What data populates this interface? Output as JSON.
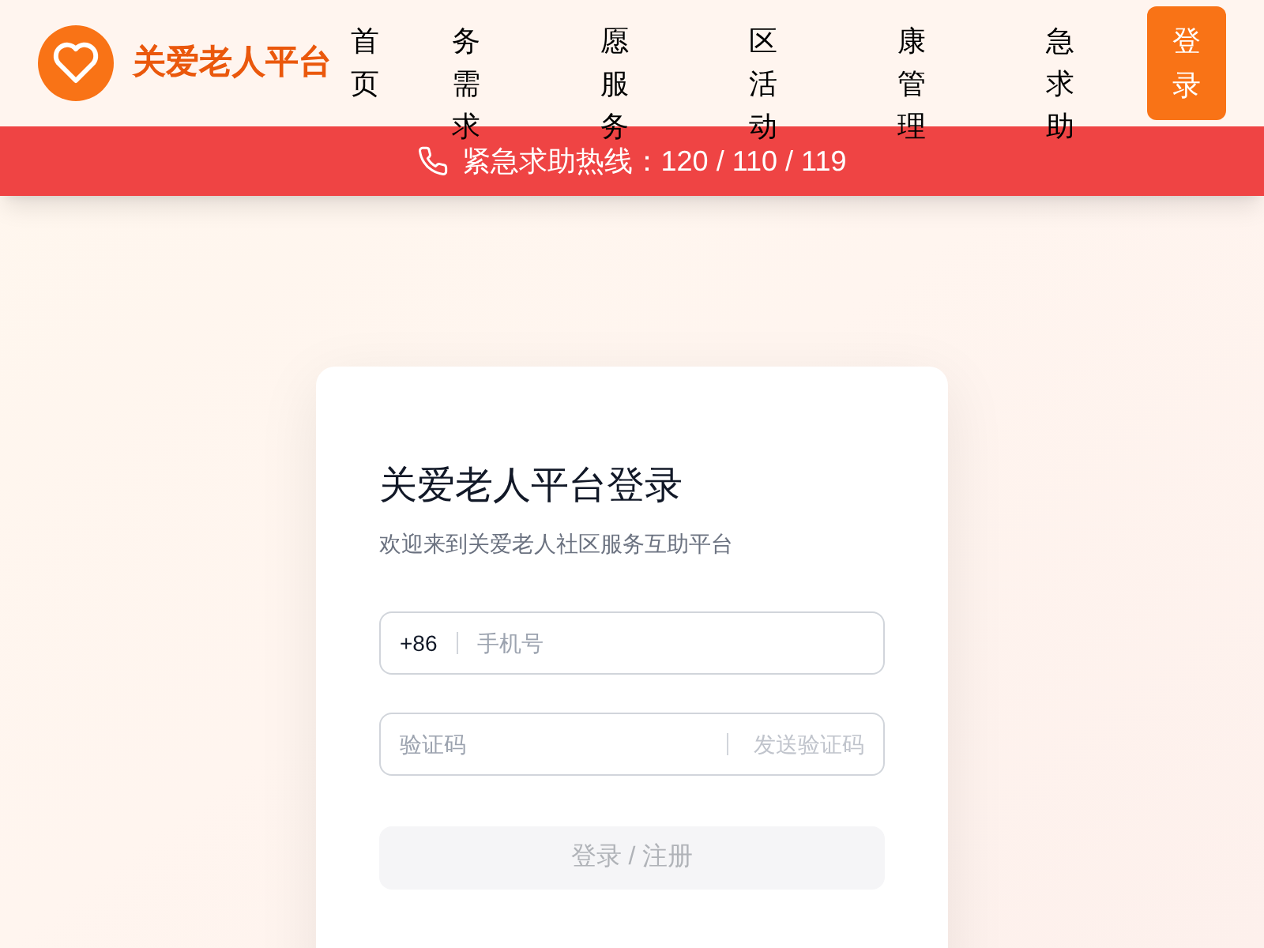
{
  "header": {
    "logo_text": "关爱老人平台",
    "nav": [
      {
        "label": "首页"
      },
      {
        "label": "务需求"
      },
      {
        "label": "愿服务"
      },
      {
        "label": "区活动"
      },
      {
        "label": "康管理"
      },
      {
        "label": "急求助"
      }
    ],
    "login_button": "登录"
  },
  "hotline_bar": {
    "text": "紧急求助热线：120 / 110 / 119"
  },
  "login_card": {
    "title": "关爱老人平台登录",
    "subtitle": "欢迎来到关爱老人社区服务互助平台",
    "phone_prefix": "+86",
    "phone_placeholder": "手机号",
    "code_placeholder": "验证码",
    "send_code": "发送验证码",
    "submit": {
      "label": "登录 / 注册",
      "disabled": true
    }
  }
}
